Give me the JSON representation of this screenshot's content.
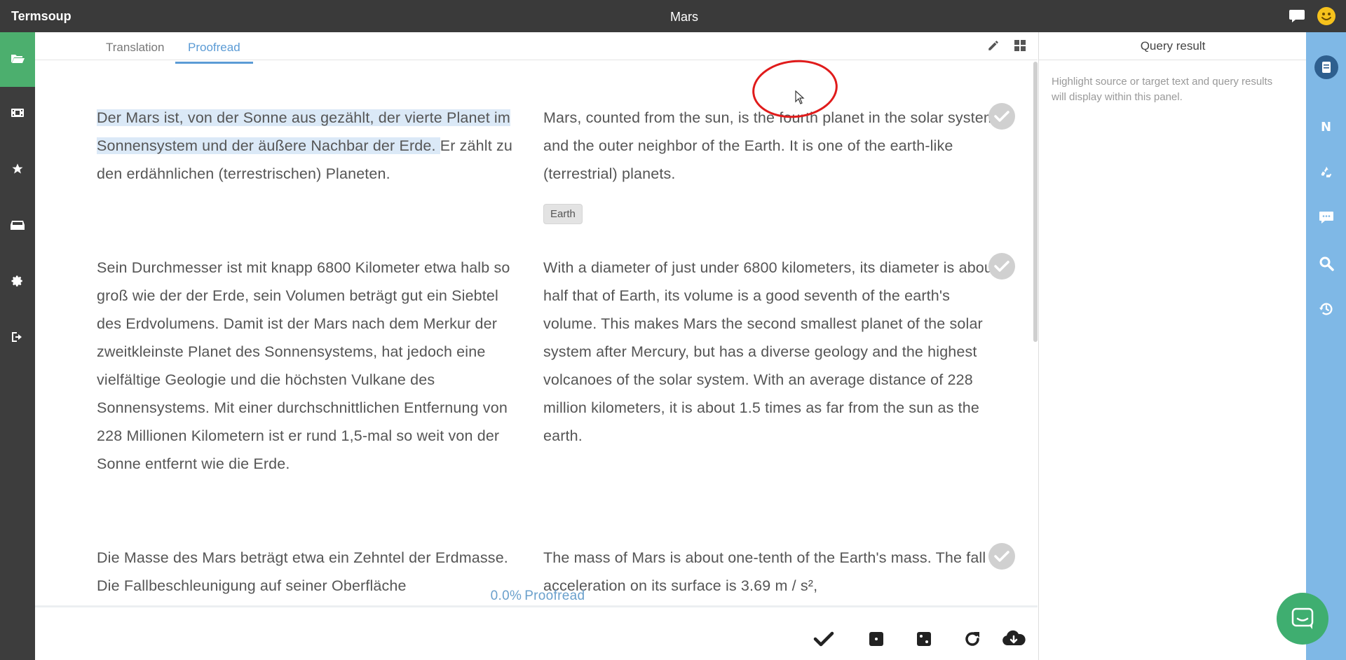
{
  "app": {
    "brand": "Termsoup",
    "document_title": "Mars"
  },
  "left_sidebar": {
    "items": [
      {
        "icon": "folder-open-icon",
        "active": true
      },
      {
        "icon": "film-icon",
        "active": false
      },
      {
        "icon": "star-icon",
        "active": false
      },
      {
        "icon": "inbox-icon",
        "active": false
      },
      {
        "icon": "gear-icon",
        "active": false
      },
      {
        "icon": "sign-out-icon",
        "active": false
      }
    ]
  },
  "tabs": [
    {
      "label": "Translation",
      "active": false
    },
    {
      "label": "Proofread",
      "active": true
    }
  ],
  "segments": [
    {
      "source_highlighted": "Der Mars ist, von der Sonne aus gezählt, der vierte Planet im Sonnensystem und der äußere Nachbar der Erde. ",
      "source_rest": "Er zählt zu den erdähnlichen (terrestrischen) Planeten.",
      "target": "Mars, counted from the sun, is the fourth planet in the solar system and the outer neighbor of the Earth.  It is one of the earth-like (terrestrial) planets.",
      "term_tags": [
        "Earth"
      ],
      "confirmed": false
    },
    {
      "source": "Sein Durchmesser ist mit knapp 6800 Kilometer etwa halb so groß wie der der Erde, sein Volumen beträgt gut ein Siebtel des Erdvolumens. Damit ist der Mars nach dem Merkur der zweitkleinste Planet des Sonnensystems, hat jedoch eine vielfältige Geologie und die höchsten Vulkane des Sonnensystems. Mit einer durchschnittlichen Entfernung von 228 Millionen Kilometern ist er rund 1,5-mal so weit von der Sonne entfernt wie die Erde.",
      "target": "With a diameter of just under 6800 kilometers, its diameter is about half that of Earth, its volume is a good seventh of the earth's volume.  This makes Mars the second smallest planet of the solar system after Mercury, but has a diverse geology and the highest volcanoes of the solar system.  With an average distance of 228 million kilometers, it is about 1.5 times as far from the sun as the earth.",
      "confirmed": false
    },
    {
      "source": "Die Masse des Mars beträgt etwa ein Zehntel der Erdmasse. Die Fallbeschleunigung auf seiner Oberfläche",
      "target": "The mass of Mars is about one-tenth of the Earth's mass.  The fall acceleration on its surface is 3.69 m / s²,",
      "confirmed": false
    }
  ],
  "progress": {
    "percent": "0.0%",
    "label": "Proofread"
  },
  "bottom_toolbar": [
    "check-icon",
    "square-icon",
    "dice-icon",
    "redo-icon",
    "cloud-download-icon"
  ],
  "query_panel": {
    "title": "Query result",
    "hint": "Highlight source or target text and query results will display within this panel."
  },
  "right_bar": {
    "items": [
      {
        "icon": "notebook-icon"
      },
      {
        "icon": "n-letter-icon",
        "text": "N"
      },
      {
        "icon": "recycle-icon"
      },
      {
        "icon": "comment-icon"
      },
      {
        "icon": "search-icon"
      },
      {
        "icon": "history-icon"
      }
    ]
  },
  "colors": {
    "topbar": "#3a3a3a",
    "sidebar_active": "#4caf6e",
    "accent_blue": "#5b9bd5",
    "right_bar": "#7fb8e6",
    "highlight": "#dbe9f7",
    "annotation_red": "#e01b1b",
    "chat_launcher": "#3fae70"
  }
}
